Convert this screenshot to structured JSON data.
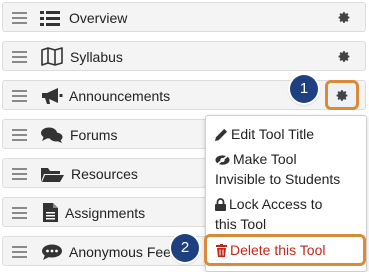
{
  "tools": [
    {
      "label": "Overview",
      "icon": "list-icon"
    },
    {
      "label": "Syllabus",
      "icon": "map-icon"
    },
    {
      "label": "Announcements",
      "icon": "megaphone-icon"
    },
    {
      "label": "Forums",
      "icon": "comments-icon"
    },
    {
      "label": "Resources",
      "icon": "folder-open-icon"
    },
    {
      "label": "Assignments",
      "icon": "file-icon"
    },
    {
      "label": "Anonymous Fee",
      "icon": "comment-dots-icon"
    }
  ],
  "callouts": {
    "step1": "1",
    "step2": "2"
  },
  "menu": {
    "edit_title": "Edit Tool Title",
    "make_invisible_line1": "Make Tool",
    "make_invisible_line2": "Invisible to Students",
    "lock_access_line1": "Lock Access to",
    "lock_access_line2": "this Tool",
    "delete": "Delete this Tool"
  },
  "colors": {
    "highlight": "#d98b3a",
    "callout": "#1e3f80",
    "danger": "#c0271a"
  }
}
